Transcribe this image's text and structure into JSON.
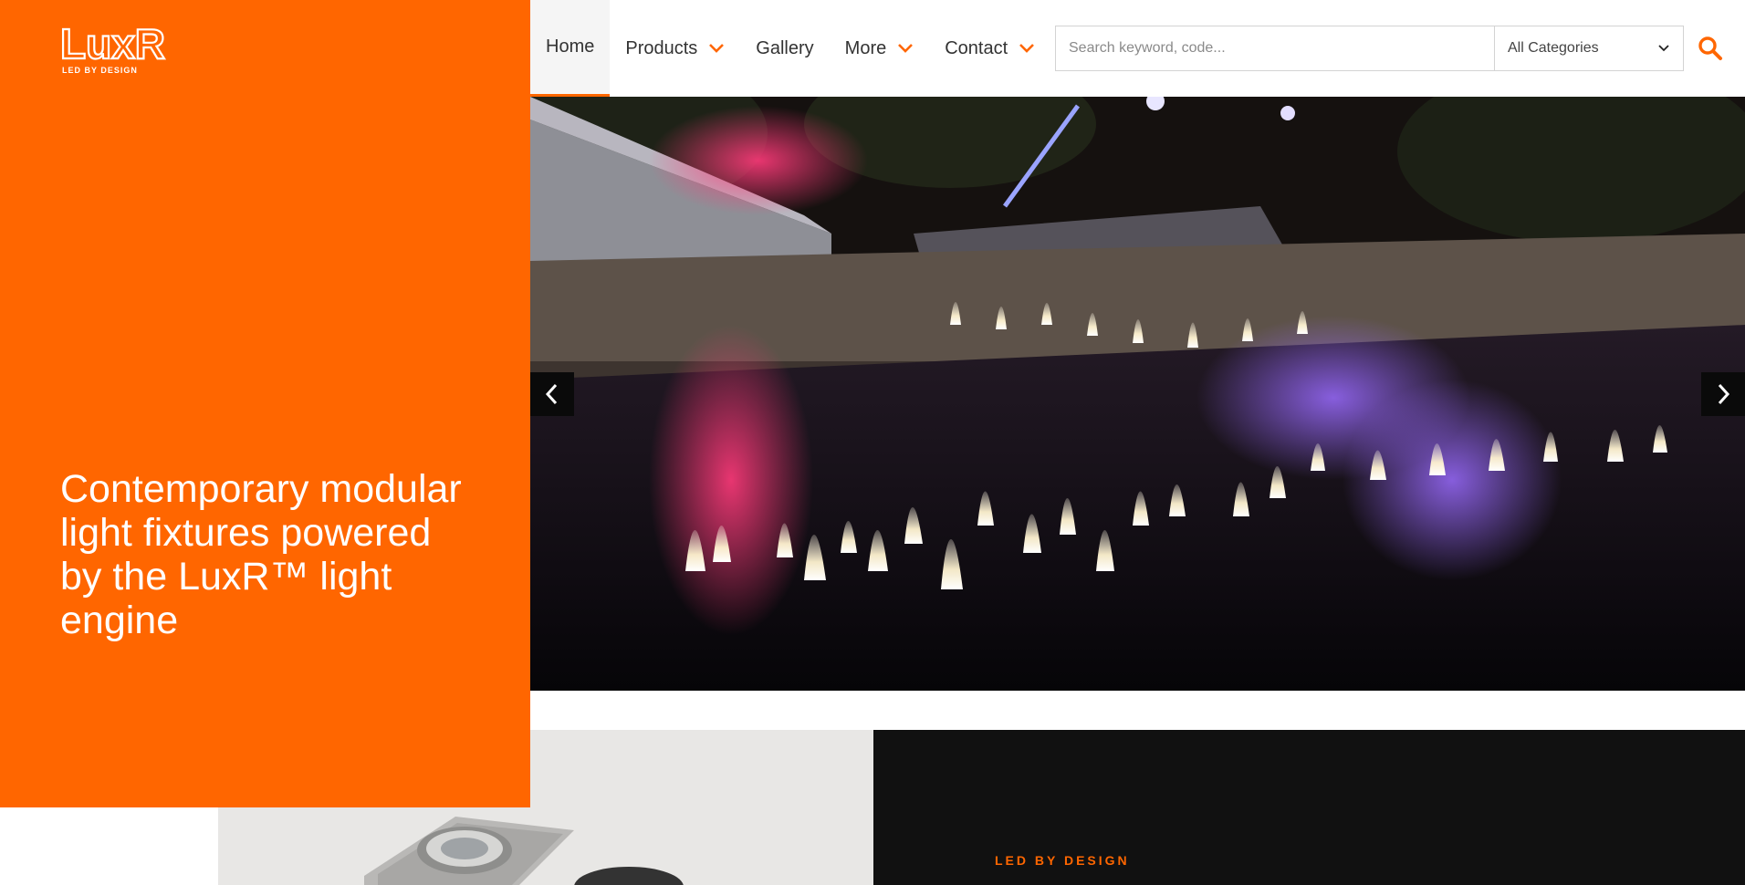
{
  "brand": {
    "logo_text": "LuxR",
    "logo_subtext": "LED BY DESIGN",
    "accent_color": "#ff6600"
  },
  "nav": {
    "items": [
      {
        "label": "Home",
        "active": true,
        "dropdown": false
      },
      {
        "label": "Products",
        "active": false,
        "dropdown": true
      },
      {
        "label": "Gallery",
        "active": false,
        "dropdown": false
      },
      {
        "label": "More",
        "active": false,
        "dropdown": true
      },
      {
        "label": "Contact",
        "active": false,
        "dropdown": true
      }
    ]
  },
  "search": {
    "placeholder": "Search keyword, code...",
    "value": "",
    "category_selected": "All Categories",
    "button_icon": "search-icon"
  },
  "hero": {
    "headline": "Contemporary modular light fixtures powered by the LuxR™ light engine"
  },
  "slider": {
    "prev_icon": "chevron-left-icon",
    "next_icon": "chevron-right-icon"
  },
  "section": {
    "tagline": "LED BY DESIGN"
  }
}
